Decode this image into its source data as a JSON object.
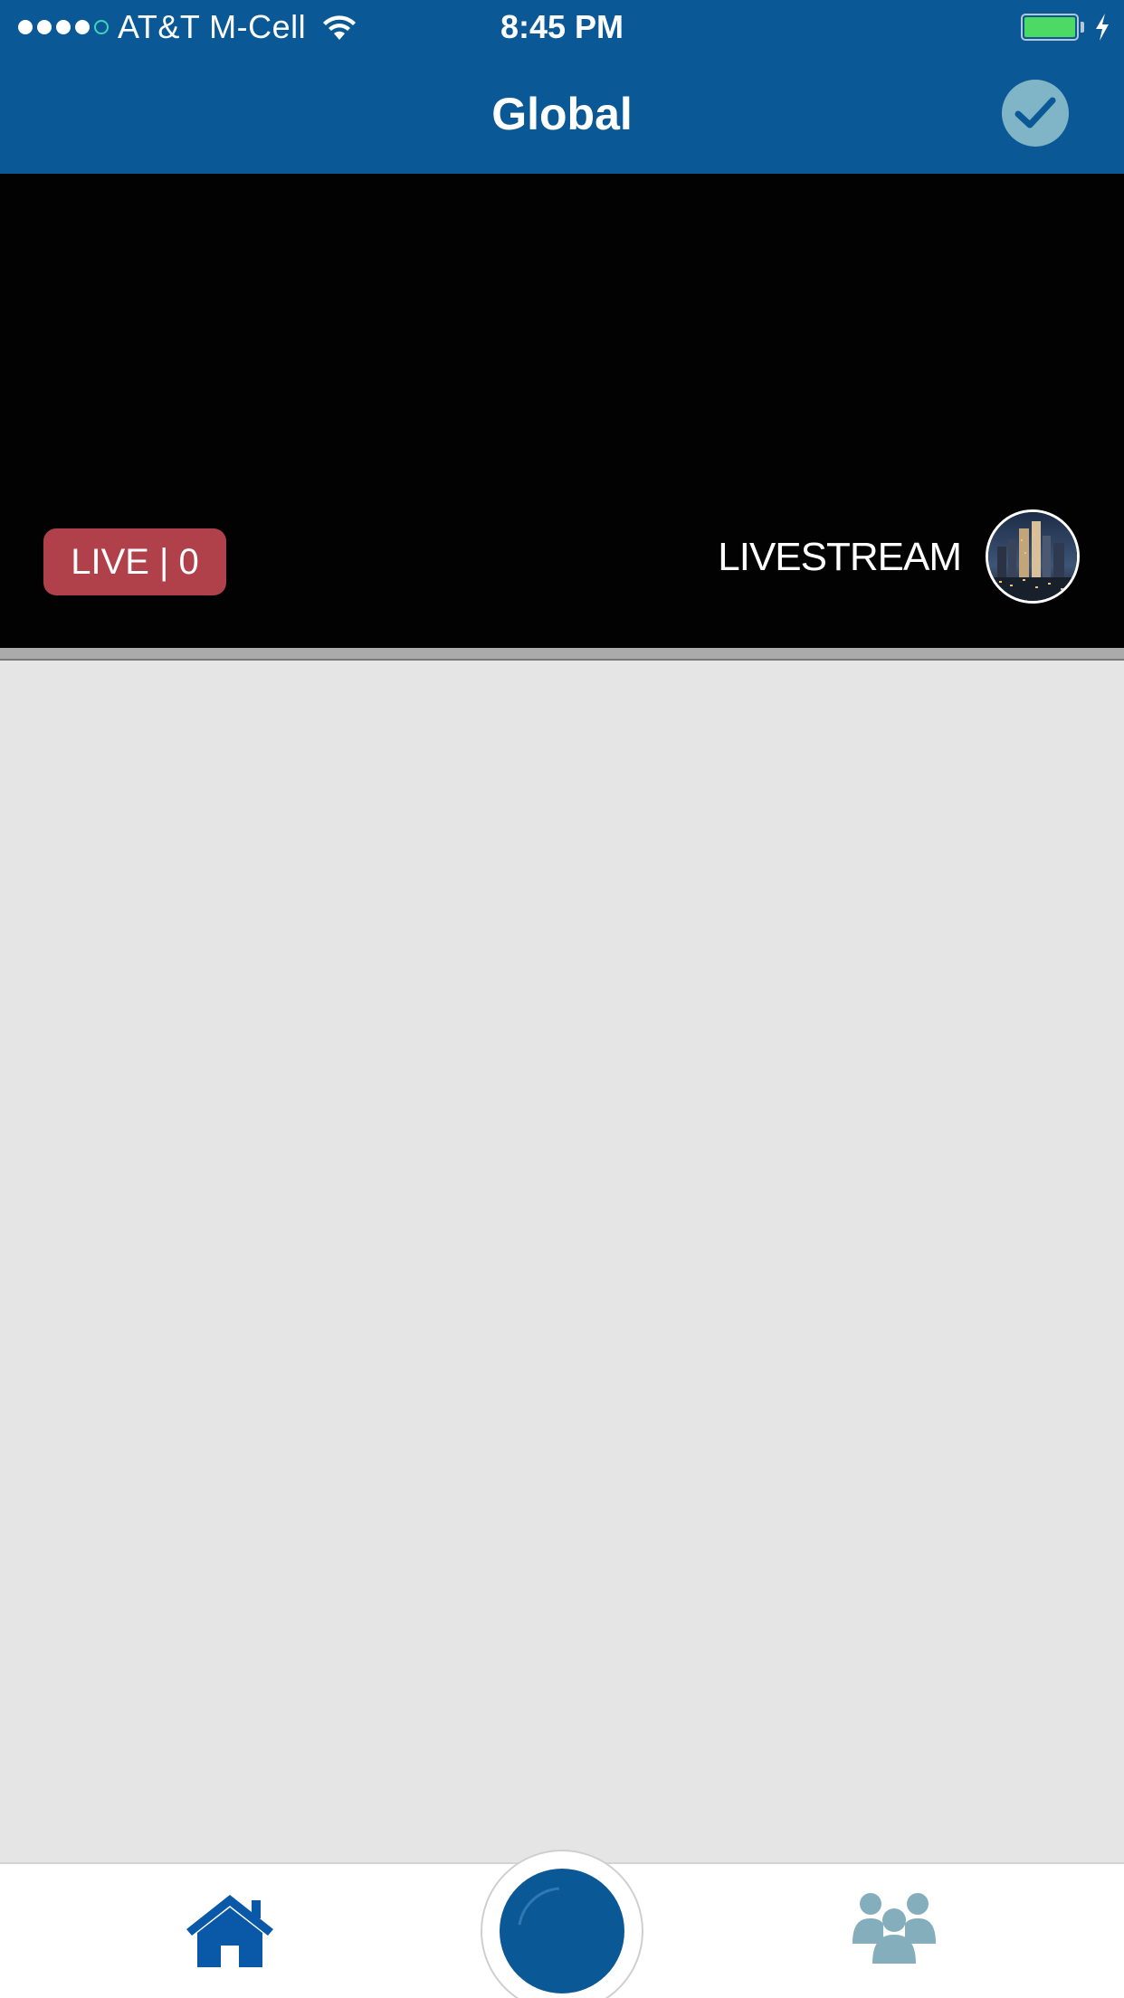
{
  "status_bar": {
    "carrier": "AT&T M-Cell",
    "time": "8:45 PM",
    "signal_bars_filled": 4,
    "signal_bars_total": 5,
    "battery_level": 1.0,
    "charging": true
  },
  "nav": {
    "title": "Global",
    "action_icon": "checkmark-icon"
  },
  "video": {
    "live_badge": "LIVE | 0",
    "stream_label": "LIVESTREAM",
    "avatar_icon": "city-skyline-thumbnail"
  },
  "tab_bar": {
    "items": [
      {
        "icon": "home-icon"
      },
      {
        "icon": "record-button"
      },
      {
        "icon": "people-icon"
      }
    ]
  },
  "colors": {
    "brand_blue": "#0a5996",
    "check_bg": "#7fb5c6",
    "live_red": "#b04049",
    "people_icon": "#84aebc",
    "content_bg": "#e5e5e5"
  }
}
